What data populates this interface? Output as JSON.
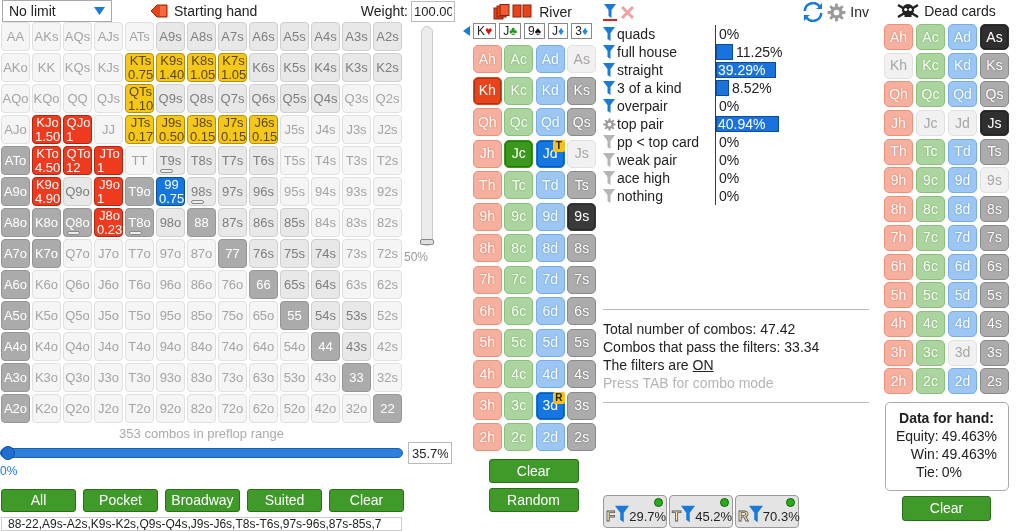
{
  "range_panel": {
    "game_select": {
      "value": "No limit"
    },
    "title": "Starting hand",
    "weight": {
      "label": "Weight:",
      "value": "100.00"
    },
    "hand_grid": [
      [
        {
          "label": "AA",
          "kind": "faded",
          "marker": false
        },
        {
          "label": "AKs",
          "kind": "faded",
          "marker": false
        },
        {
          "label": "AQs",
          "kind": "faded",
          "marker": false
        },
        {
          "label": "AJs",
          "kind": "faded",
          "marker": false
        },
        {
          "label": "ATs",
          "kind": "faded",
          "marker": false
        },
        {
          "label": "A9s",
          "kind": "plain",
          "marker": false
        },
        {
          "label": "A8s",
          "kind": "plain",
          "marker": false
        },
        {
          "label": "A7s",
          "kind": "plain",
          "marker": false
        },
        {
          "label": "A6s",
          "kind": "plain",
          "marker": false
        },
        {
          "label": "A5s",
          "kind": "plain",
          "marker": false
        },
        {
          "label": "A4s",
          "kind": "plain",
          "marker": false
        },
        {
          "label": "A3s",
          "kind": "plain",
          "marker": false
        },
        {
          "label": "A2s",
          "kind": "plain",
          "marker": false
        }
      ],
      [
        {
          "label": "AKo",
          "kind": "faded",
          "marker": false
        },
        {
          "label": "KK",
          "kind": "faded",
          "marker": false
        },
        {
          "label": "KQs",
          "kind": "faded",
          "marker": false
        },
        {
          "label": "KJs",
          "kind": "faded",
          "marker": false
        },
        {
          "label": "KTs",
          "kind": "yellow",
          "weight": "0.75",
          "marker": false
        },
        {
          "label": "K9s",
          "kind": "yellow",
          "weight": "1.40",
          "marker": false
        },
        {
          "label": "K8s",
          "kind": "yellow",
          "weight": "1.05",
          "marker": false
        },
        {
          "label": "K7s",
          "kind": "yellow",
          "weight": "1.05",
          "marker": false
        },
        {
          "label": "K6s",
          "kind": "plain",
          "marker": false
        },
        {
          "label": "K5s",
          "kind": "plain",
          "marker": false
        },
        {
          "label": "K4s",
          "kind": "plain",
          "marker": false
        },
        {
          "label": "K3s",
          "kind": "plain",
          "marker": false
        },
        {
          "label": "K2s",
          "kind": "plain",
          "marker": false
        }
      ],
      [
        {
          "label": "AQo",
          "kind": "faded",
          "marker": false
        },
        {
          "label": "KQo",
          "kind": "faded",
          "marker": false
        },
        {
          "label": "QQ",
          "kind": "faded",
          "marker": false
        },
        {
          "label": "QJs",
          "kind": "faded",
          "marker": false
        },
        {
          "label": "QTs",
          "kind": "yellow",
          "weight": "1.10",
          "marker": false
        },
        {
          "label": "Q9s",
          "kind": "plain",
          "marker": false
        },
        {
          "label": "Q8s",
          "kind": "plain",
          "marker": false
        },
        {
          "label": "Q7s",
          "kind": "plain",
          "marker": false
        },
        {
          "label": "Q6s",
          "kind": "plain",
          "marker": false
        },
        {
          "label": "Q5s",
          "kind": "plain",
          "marker": false
        },
        {
          "label": "Q4s",
          "kind": "plain",
          "marker": false
        },
        {
          "label": "Q3s",
          "kind": "faded",
          "marker": false
        },
        {
          "label": "Q2s",
          "kind": "faded",
          "marker": false
        }
      ],
      [
        {
          "label": "AJo",
          "kind": "faded",
          "marker": false
        },
        {
          "label": "KJo",
          "kind": "red",
          "weight": "1.50",
          "marker": false
        },
        {
          "label": "QJo",
          "kind": "red",
          "weight": "1",
          "marker": false
        },
        {
          "label": "JJ",
          "kind": "faded",
          "marker": false
        },
        {
          "label": "JTs",
          "kind": "yellow",
          "weight": "0.17",
          "marker": false
        },
        {
          "label": "J9s",
          "kind": "yellow",
          "weight": "0.50",
          "marker": false
        },
        {
          "label": "J8s",
          "kind": "yellow",
          "weight": "0.15",
          "marker": false
        },
        {
          "label": "J7s",
          "kind": "yellow",
          "weight": "0.15",
          "marker": false
        },
        {
          "label": "J6s",
          "kind": "yellow",
          "weight": "0.15",
          "marker": false
        },
        {
          "label": "J5s",
          "kind": "faded",
          "marker": false
        },
        {
          "label": "J4s",
          "kind": "faded",
          "marker": false
        },
        {
          "label": "J3s",
          "kind": "faded",
          "marker": false
        },
        {
          "label": "J2s",
          "kind": "faded",
          "marker": false
        }
      ],
      [
        {
          "label": "ATo",
          "kind": "grey",
          "marker": false
        },
        {
          "label": "KTo",
          "kind": "red",
          "weight": "4.50",
          "marker": false
        },
        {
          "label": "QTo",
          "kind": "red",
          "weight": "12",
          "marker": false
        },
        {
          "label": "JTo",
          "kind": "red",
          "weight": "1",
          "marker": false
        },
        {
          "label": "TT",
          "kind": "faded",
          "marker": false
        },
        {
          "label": "T9s",
          "kind": "plain",
          "marker": true
        },
        {
          "label": "T8s",
          "kind": "plain",
          "marker": false
        },
        {
          "label": "T7s",
          "kind": "plain",
          "marker": false
        },
        {
          "label": "T6s",
          "kind": "plain",
          "marker": false
        },
        {
          "label": "T5s",
          "kind": "faded",
          "marker": false
        },
        {
          "label": "T4s",
          "kind": "faded",
          "marker": false
        },
        {
          "label": "T3s",
          "kind": "faded",
          "marker": false
        },
        {
          "label": "T2s",
          "kind": "faded",
          "marker": false
        }
      ],
      [
        {
          "label": "A9o",
          "kind": "grey",
          "marker": false
        },
        {
          "label": "K9o",
          "kind": "red",
          "weight": "4.90",
          "marker": false
        },
        {
          "label": "Q9o",
          "kind": "plain",
          "marker": false
        },
        {
          "label": "J9o",
          "kind": "red",
          "weight": "1",
          "marker": false
        },
        {
          "label": "T9o",
          "kind": "grey",
          "marker": false
        },
        {
          "label": "99",
          "kind": "blue",
          "weight": "0.75",
          "marker": false
        },
        {
          "label": "98s",
          "kind": "plain",
          "marker": true
        },
        {
          "label": "97s",
          "kind": "plain",
          "marker": false
        },
        {
          "label": "96s",
          "kind": "plain",
          "marker": false
        },
        {
          "label": "95s",
          "kind": "faded",
          "marker": false
        },
        {
          "label": "94s",
          "kind": "faded",
          "marker": false
        },
        {
          "label": "93s",
          "kind": "faded",
          "marker": false
        },
        {
          "label": "92s",
          "kind": "faded",
          "marker": false
        }
      ],
      [
        {
          "label": "A8o",
          "kind": "grey",
          "marker": false
        },
        {
          "label": "K8o",
          "kind": "grey",
          "marker": false
        },
        {
          "label": "Q8o",
          "kind": "grey",
          "marker": true
        },
        {
          "label": "J8o",
          "kind": "red",
          "weight": "0.23",
          "marker": false
        },
        {
          "label": "T8o",
          "kind": "grey",
          "marker": true
        },
        {
          "label": "98o",
          "kind": "plain",
          "marker": false
        },
        {
          "label": "88",
          "kind": "grey",
          "marker": false
        },
        {
          "label": "87s",
          "kind": "plain",
          "marker": false
        },
        {
          "label": "86s",
          "kind": "plain",
          "marker": false
        },
        {
          "label": "85s",
          "kind": "plain",
          "marker": false
        },
        {
          "label": "84s",
          "kind": "faded",
          "marker": false
        },
        {
          "label": "83s",
          "kind": "faded",
          "marker": false
        },
        {
          "label": "82s",
          "kind": "faded",
          "marker": false
        }
      ],
      [
        {
          "label": "A7o",
          "kind": "grey",
          "marker": false
        },
        {
          "label": "K7o",
          "kind": "grey",
          "marker": false
        },
        {
          "label": "Q7o",
          "kind": "faded",
          "marker": false
        },
        {
          "label": "J7o",
          "kind": "faded",
          "marker": false
        },
        {
          "label": "T7o",
          "kind": "faded",
          "marker": false
        },
        {
          "label": "97o",
          "kind": "faded",
          "marker": false
        },
        {
          "label": "87o",
          "kind": "faded",
          "marker": false
        },
        {
          "label": "77",
          "kind": "grey",
          "marker": false
        },
        {
          "label": "76s",
          "kind": "plain",
          "marker": false
        },
        {
          "label": "75s",
          "kind": "plain",
          "marker": false
        },
        {
          "label": "74s",
          "kind": "plain",
          "marker": false
        },
        {
          "label": "73s",
          "kind": "faded",
          "marker": false
        },
        {
          "label": "72s",
          "kind": "faded",
          "marker": false
        }
      ],
      [
        {
          "label": "A6o",
          "kind": "grey",
          "marker": false
        },
        {
          "label": "K6o",
          "kind": "faded",
          "marker": false
        },
        {
          "label": "Q6o",
          "kind": "faded",
          "marker": false
        },
        {
          "label": "J6o",
          "kind": "faded",
          "marker": false
        },
        {
          "label": "T6o",
          "kind": "faded",
          "marker": false
        },
        {
          "label": "96o",
          "kind": "faded",
          "marker": false
        },
        {
          "label": "86o",
          "kind": "faded",
          "marker": false
        },
        {
          "label": "76o",
          "kind": "faded",
          "marker": false
        },
        {
          "label": "66",
          "kind": "grey",
          "marker": false
        },
        {
          "label": "65s",
          "kind": "plain",
          "marker": false
        },
        {
          "label": "64s",
          "kind": "plain",
          "marker": false
        },
        {
          "label": "63s",
          "kind": "faded",
          "marker": false
        },
        {
          "label": "62s",
          "kind": "faded",
          "marker": false
        }
      ],
      [
        {
          "label": "A5o",
          "kind": "grey",
          "marker": false
        },
        {
          "label": "K5o",
          "kind": "faded",
          "marker": false
        },
        {
          "label": "Q5o",
          "kind": "faded",
          "marker": false
        },
        {
          "label": "J5o",
          "kind": "faded",
          "marker": false
        },
        {
          "label": "T5o",
          "kind": "faded",
          "marker": false
        },
        {
          "label": "95o",
          "kind": "faded",
          "marker": false
        },
        {
          "label": "85o",
          "kind": "faded",
          "marker": false
        },
        {
          "label": "75o",
          "kind": "faded",
          "marker": false
        },
        {
          "label": "65o",
          "kind": "faded",
          "marker": false
        },
        {
          "label": "55",
          "kind": "grey",
          "marker": false
        },
        {
          "label": "54s",
          "kind": "plain",
          "marker": false
        },
        {
          "label": "53s",
          "kind": "plain",
          "marker": false
        },
        {
          "label": "52s",
          "kind": "faded",
          "marker": false
        }
      ],
      [
        {
          "label": "A4o",
          "kind": "grey",
          "marker": false
        },
        {
          "label": "K4o",
          "kind": "faded",
          "marker": false
        },
        {
          "label": "Q4o",
          "kind": "faded",
          "marker": false
        },
        {
          "label": "J4o",
          "kind": "faded",
          "marker": false
        },
        {
          "label": "T4o",
          "kind": "faded",
          "marker": false
        },
        {
          "label": "94o",
          "kind": "faded",
          "marker": false
        },
        {
          "label": "84o",
          "kind": "faded",
          "marker": false
        },
        {
          "label": "74o",
          "kind": "faded",
          "marker": false
        },
        {
          "label": "64o",
          "kind": "faded",
          "marker": false
        },
        {
          "label": "54o",
          "kind": "faded",
          "marker": false
        },
        {
          "label": "44",
          "kind": "grey",
          "marker": false
        },
        {
          "label": "43s",
          "kind": "plain",
          "marker": false
        },
        {
          "label": "42s",
          "kind": "faded",
          "marker": false
        }
      ],
      [
        {
          "label": "A3o",
          "kind": "grey",
          "marker": false
        },
        {
          "label": "K3o",
          "kind": "faded",
          "marker": false
        },
        {
          "label": "Q3o",
          "kind": "faded",
          "marker": false
        },
        {
          "label": "J3o",
          "kind": "faded",
          "marker": false
        },
        {
          "label": "T3o",
          "kind": "faded",
          "marker": false
        },
        {
          "label": "93o",
          "kind": "faded",
          "marker": false
        },
        {
          "label": "83o",
          "kind": "faded",
          "marker": false
        },
        {
          "label": "73o",
          "kind": "faded",
          "marker": false
        },
        {
          "label": "63o",
          "kind": "faded",
          "marker": false
        },
        {
          "label": "53o",
          "kind": "faded",
          "marker": false
        },
        {
          "label": "43o",
          "kind": "faded",
          "marker": false
        },
        {
          "label": "33",
          "kind": "grey",
          "marker": false
        },
        {
          "label": "32s",
          "kind": "faded",
          "marker": false
        }
      ],
      [
        {
          "label": "A2o",
          "kind": "grey",
          "marker": false
        },
        {
          "label": "K2o",
          "kind": "faded",
          "marker": false
        },
        {
          "label": "Q2o",
          "kind": "faded",
          "marker": false
        },
        {
          "label": "J2o",
          "kind": "faded",
          "marker": false
        },
        {
          "label": "T2o",
          "kind": "faded",
          "marker": false
        },
        {
          "label": "92o",
          "kind": "faded",
          "marker": false
        },
        {
          "label": "82o",
          "kind": "faded",
          "marker": false
        },
        {
          "label": "72o",
          "kind": "faded",
          "marker": false
        },
        {
          "label": "62o",
          "kind": "faded",
          "marker": false
        },
        {
          "label": "52o",
          "kind": "faded",
          "marker": false
        },
        {
          "label": "42o",
          "kind": "faded",
          "marker": false
        },
        {
          "label": "32o",
          "kind": "faded",
          "marker": false
        },
        {
          "label": "22",
          "kind": "grey",
          "marker": false
        }
      ]
    ],
    "weight_slider": {
      "level": 0,
      "reading": "50%"
    },
    "combo_caption": "353 combos in preflop range",
    "range_slider": {
      "level": 0,
      "reading": "0%",
      "value": "35.7%"
    },
    "buttons": [
      "All",
      "Pocket",
      "Broadway",
      "Suited",
      "Clear"
    ],
    "range_text": "88-22,A9s-A2s,K9s-K2s,Q9s-Q4s,J9s-J6s,T8s-T6s,97s-96s,87s-85s,7"
  },
  "board_panel": {
    "title": "River",
    "board": [
      {
        "rank": "K",
        "symbol": "♥",
        "color": "#e01010"
      },
      {
        "rank": "J",
        "symbol": "♣",
        "color": "#1a9a1a"
      },
      {
        "rank": "9",
        "symbol": "♠",
        "color": "#111111"
      },
      {
        "rank": "J",
        "symbol": "♦",
        "color": "#1a8ae8"
      },
      {
        "rank": "3",
        "symbol": "♦",
        "color": "#1a8ae8"
      }
    ],
    "cards": [
      [
        {
          "label": "Ah",
          "kind": "heart",
          "selected": false,
          "disabled": false
        },
        {
          "label": "Ac",
          "kind": "club",
          "selected": false,
          "disabled": false
        },
        {
          "label": "Ad",
          "kind": "diamond",
          "selected": false,
          "disabled": false
        },
        {
          "label": "As",
          "kind": "spade",
          "selected": false,
          "disabled": true
        }
      ],
      [
        {
          "label": "Kh",
          "kind": "heart",
          "selected": true,
          "disabled": false
        },
        {
          "label": "Kc",
          "kind": "club",
          "selected": false,
          "disabled": false
        },
        {
          "label": "Kd",
          "kind": "diamond",
          "selected": false,
          "disabled": false
        },
        {
          "label": "Ks",
          "kind": "spade",
          "selected": false,
          "disabled": false
        }
      ],
      [
        {
          "label": "Qh",
          "kind": "heart",
          "selected": false,
          "disabled": false
        },
        {
          "label": "Qc",
          "kind": "club",
          "selected": false,
          "disabled": false
        },
        {
          "label": "Qd",
          "kind": "diamond",
          "selected": false,
          "disabled": false
        },
        {
          "label": "Qs",
          "kind": "spade",
          "selected": false,
          "disabled": false
        }
      ],
      [
        {
          "label": "Jh",
          "kind": "heart",
          "selected": false,
          "disabled": false
        },
        {
          "label": "Jc",
          "kind": "club",
          "selected": true,
          "disabled": false
        },
        {
          "label": "Jd",
          "kind": "diamond",
          "selected": true,
          "disabled": false,
          "badge": "T"
        },
        {
          "label": "Js",
          "kind": "spade",
          "selected": false,
          "disabled": true
        }
      ],
      [
        {
          "label": "Th",
          "kind": "heart",
          "selected": false,
          "disabled": false
        },
        {
          "label": "Tc",
          "kind": "club",
          "selected": false,
          "disabled": false
        },
        {
          "label": "Td",
          "kind": "diamond",
          "selected": false,
          "disabled": false
        },
        {
          "label": "Ts",
          "kind": "spade",
          "selected": false,
          "disabled": false
        }
      ],
      [
        {
          "label": "9h",
          "kind": "heart",
          "selected": false,
          "disabled": false
        },
        {
          "label": "9c",
          "kind": "club",
          "selected": false,
          "disabled": false
        },
        {
          "label": "9d",
          "kind": "diamond",
          "selected": false,
          "disabled": false
        },
        {
          "label": "9s",
          "kind": "spade",
          "selected": true,
          "disabled": false
        }
      ],
      [
        {
          "label": "8h",
          "kind": "heart",
          "selected": false,
          "disabled": false
        },
        {
          "label": "8c",
          "kind": "club",
          "selected": false,
          "disabled": false
        },
        {
          "label": "8d",
          "kind": "diamond",
          "selected": false,
          "disabled": false
        },
        {
          "label": "8s",
          "kind": "spade",
          "selected": false,
          "disabled": false
        }
      ],
      [
        {
          "label": "7h",
          "kind": "heart",
          "selected": false,
          "disabled": false
        },
        {
          "label": "7c",
          "kind": "club",
          "selected": false,
          "disabled": false
        },
        {
          "label": "7d",
          "kind": "diamond",
          "selected": false,
          "disabled": false
        },
        {
          "label": "7s",
          "kind": "spade",
          "selected": false,
          "disabled": false
        }
      ],
      [
        {
          "label": "6h",
          "kind": "heart",
          "selected": false,
          "disabled": false
        },
        {
          "label": "6c",
          "kind": "club",
          "selected": false,
          "disabled": false
        },
        {
          "label": "6d",
          "kind": "diamond",
          "selected": false,
          "disabled": false
        },
        {
          "label": "6s",
          "kind": "spade",
          "selected": false,
          "disabled": false
        }
      ],
      [
        {
          "label": "5h",
          "kind": "heart",
          "selected": false,
          "disabled": false
        },
        {
          "label": "5c",
          "kind": "club",
          "selected": false,
          "disabled": false
        },
        {
          "label": "5d",
          "kind": "diamond",
          "selected": false,
          "disabled": false
        },
        {
          "label": "5s",
          "kind": "spade",
          "selected": false,
          "disabled": false
        }
      ],
      [
        {
          "label": "4h",
          "kind": "heart",
          "selected": false,
          "disabled": false
        },
        {
          "label": "4c",
          "kind": "club",
          "selected": false,
          "disabled": false
        },
        {
          "label": "4d",
          "kind": "diamond",
          "selected": false,
          "disabled": false
        },
        {
          "label": "4s",
          "kind": "spade",
          "selected": false,
          "disabled": false
        }
      ],
      [
        {
          "label": "3h",
          "kind": "heart",
          "selected": false,
          "disabled": false
        },
        {
          "label": "3c",
          "kind": "club",
          "selected": false,
          "disabled": false
        },
        {
          "label": "3d",
          "kind": "diamond",
          "selected": true,
          "disabled": false,
          "badge": "R"
        },
        {
          "label": "3s",
          "kind": "spade",
          "selected": false,
          "disabled": false
        }
      ],
      [
        {
          "label": "2h",
          "kind": "heart",
          "selected": false,
          "disabled": false
        },
        {
          "label": "2c",
          "kind": "club",
          "selected": false,
          "disabled": false
        },
        {
          "label": "2d",
          "kind": "diamond",
          "selected": false,
          "disabled": false
        },
        {
          "label": "2s",
          "kind": "spade",
          "selected": false,
          "disabled": false
        }
      ]
    ],
    "buttons": [
      "Clear",
      "Random"
    ]
  },
  "stats_panel": {
    "inv_label": "Inv",
    "hand_classes": [
      {
        "label": "quads",
        "kind": "filter",
        "on": true,
        "value": "0%"
      },
      {
        "label": "full house",
        "kind": "filter",
        "on": true,
        "level": 0.1125,
        "value": "11.25%"
      },
      {
        "label": "straight",
        "kind": "filter",
        "on": true,
        "level": 0.3929,
        "value": "39.29%"
      },
      {
        "label": "3 of a kind",
        "kind": "filter",
        "on": true,
        "level": 0.0852,
        "value": "8.52%"
      },
      {
        "label": "overpair",
        "kind": "filter",
        "on": true,
        "value": "0%"
      },
      {
        "label": "top pair",
        "kind": "gear",
        "on": true,
        "level": 0.4094,
        "value": "40.94%"
      },
      {
        "label": "pp < top card",
        "kind": "filter",
        "on": false,
        "value": "0%"
      },
      {
        "label": "weak pair",
        "kind": "filter",
        "on": false,
        "value": "0%"
      },
      {
        "label": "ace high",
        "kind": "filter",
        "on": false,
        "value": "0%"
      },
      {
        "label": "nothing",
        "kind": "filter",
        "on": false,
        "value": "0%"
      }
    ],
    "summary": [
      "Total number of combos: 47.42",
      "Combos that pass the filters: 33.34"
    ],
    "filters_state": {
      "label": "The filters are",
      "value": "ON"
    },
    "hint": "Press TAB for combo mode",
    "street_filters": [
      {
        "letter": "F",
        "value": "29.7%",
        "active": true
      },
      {
        "letter": "T",
        "value": "45.2%",
        "active": true
      },
      {
        "letter": "R",
        "value": "70.3%",
        "active": true
      }
    ]
  },
  "dead_panel": {
    "title": "Dead cards",
    "cards": [
      [
        {
          "label": "Ah",
          "kind": "heart",
          "selected": false,
          "disabled": false
        },
        {
          "label": "Ac",
          "kind": "club",
          "selected": false,
          "disabled": false
        },
        {
          "label": "Ad",
          "kind": "diamond",
          "selected": false,
          "disabled": false
        },
        {
          "label": "As",
          "kind": "spade",
          "selected": true,
          "disabled": false
        }
      ],
      [
        {
          "label": "Kh",
          "kind": "heart",
          "selected": false,
          "disabled": true
        },
        {
          "label": "Kc",
          "kind": "club",
          "selected": false,
          "disabled": false
        },
        {
          "label": "Kd",
          "kind": "diamond",
          "selected": false,
          "disabled": false
        },
        {
          "label": "Ks",
          "kind": "spade",
          "selected": false,
          "disabled": false
        }
      ],
      [
        {
          "label": "Qh",
          "kind": "heart",
          "selected": false,
          "disabled": false
        },
        {
          "label": "Qc",
          "kind": "club",
          "selected": false,
          "disabled": false
        },
        {
          "label": "Qd",
          "kind": "diamond",
          "selected": false,
          "disabled": false
        },
        {
          "label": "Qs",
          "kind": "spade",
          "selected": false,
          "disabled": false
        }
      ],
      [
        {
          "label": "Jh",
          "kind": "heart",
          "selected": false,
          "disabled": false
        },
        {
          "label": "Jc",
          "kind": "club",
          "selected": false,
          "disabled": true
        },
        {
          "label": "Jd",
          "kind": "diamond",
          "selected": false,
          "disabled": true
        },
        {
          "label": "Js",
          "kind": "spade",
          "selected": true,
          "disabled": false
        }
      ],
      [
        {
          "label": "Th",
          "kind": "heart",
          "selected": false,
          "disabled": false
        },
        {
          "label": "Tc",
          "kind": "club",
          "selected": false,
          "disabled": false
        },
        {
          "label": "Td",
          "kind": "diamond",
          "selected": false,
          "disabled": false
        },
        {
          "label": "Ts",
          "kind": "spade",
          "selected": false,
          "disabled": false
        }
      ],
      [
        {
          "label": "9h",
          "kind": "heart",
          "selected": false,
          "disabled": false
        },
        {
          "label": "9c",
          "kind": "club",
          "selected": false,
          "disabled": false
        },
        {
          "label": "9d",
          "kind": "diamond",
          "selected": false,
          "disabled": false
        },
        {
          "label": "9s",
          "kind": "spade",
          "selected": false,
          "disabled": true
        }
      ],
      [
        {
          "label": "8h",
          "kind": "heart",
          "selected": false,
          "disabled": false
        },
        {
          "label": "8c",
          "kind": "club",
          "selected": false,
          "disabled": false
        },
        {
          "label": "8d",
          "kind": "diamond",
          "selected": false,
          "disabled": false
        },
        {
          "label": "8s",
          "kind": "spade",
          "selected": false,
          "disabled": false
        }
      ],
      [
        {
          "label": "7h",
          "kind": "heart",
          "selected": false,
          "disabled": false
        },
        {
          "label": "7c",
          "kind": "club",
          "selected": false,
          "disabled": false
        },
        {
          "label": "7d",
          "kind": "diamond",
          "selected": false,
          "disabled": false
        },
        {
          "label": "7s",
          "kind": "spade",
          "selected": false,
          "disabled": false
        }
      ],
      [
        {
          "label": "6h",
          "kind": "heart",
          "selected": false,
          "disabled": false
        },
        {
          "label": "6c",
          "kind": "club",
          "selected": false,
          "disabled": false
        },
        {
          "label": "6d",
          "kind": "diamond",
          "selected": false,
          "disabled": false
        },
        {
          "label": "6s",
          "kind": "spade",
          "selected": false,
          "disabled": false
        }
      ],
      [
        {
          "label": "5h",
          "kind": "heart",
          "selected": false,
          "disabled": false
        },
        {
          "label": "5c",
          "kind": "club",
          "selected": false,
          "disabled": false
        },
        {
          "label": "5d",
          "kind": "diamond",
          "selected": false,
          "disabled": false
        },
        {
          "label": "5s",
          "kind": "spade",
          "selected": false,
          "disabled": false
        }
      ],
      [
        {
          "label": "4h",
          "kind": "heart",
          "selected": false,
          "disabled": false
        },
        {
          "label": "4c",
          "kind": "club",
          "selected": false,
          "disabled": false
        },
        {
          "label": "4d",
          "kind": "diamond",
          "selected": false,
          "disabled": false
        },
        {
          "label": "4s",
          "kind": "spade",
          "selected": false,
          "disabled": false
        }
      ],
      [
        {
          "label": "3h",
          "kind": "heart",
          "selected": false,
          "disabled": false
        },
        {
          "label": "3c",
          "kind": "club",
          "selected": false,
          "disabled": false
        },
        {
          "label": "3d",
          "kind": "diamond",
          "selected": false,
          "disabled": true
        },
        {
          "label": "3s",
          "kind": "spade",
          "selected": false,
          "disabled": false
        }
      ],
      [
        {
          "label": "2h",
          "kind": "heart",
          "selected": false,
          "disabled": false
        },
        {
          "label": "2c",
          "kind": "club",
          "selected": false,
          "disabled": false
        },
        {
          "label": "2d",
          "kind": "diamond",
          "selected": false,
          "disabled": false
        },
        {
          "label": "2s",
          "kind": "spade",
          "selected": false,
          "disabled": false
        }
      ]
    ],
    "hand_data": {
      "title": "Data for hand:",
      "rows": [
        {
          "label": "Equity:",
          "value": "49.463%"
        },
        {
          "label": "Win:",
          "value": "49.463%"
        },
        {
          "label": "Tie:",
          "value": "0%"
        }
      ]
    },
    "button": "Clear"
  }
}
